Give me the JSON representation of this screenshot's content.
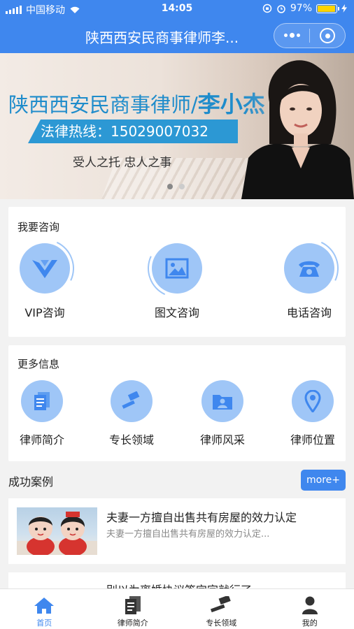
{
  "status": {
    "carrier": "中国移动",
    "time": "14:05",
    "battery": "97%",
    "battery_level": 0.97
  },
  "navbar": {
    "title": "陕西西安民商事律师李..."
  },
  "banner": {
    "title": "陕西西安民商事律师/",
    "name": "李小杰",
    "hotline": "法律热线：15029007032",
    "slogan": "受人之托   忠人之事"
  },
  "consult": {
    "title": "我要咨询",
    "items": [
      {
        "label": "VIP咨询",
        "icon": "vip-icon"
      },
      {
        "label": "图文咨询",
        "icon": "picture-icon"
      },
      {
        "label": "电话咨询",
        "icon": "phone-icon"
      }
    ]
  },
  "more_info": {
    "title": "更多信息",
    "items": [
      {
        "label": "律师简介",
        "icon": "document-icon"
      },
      {
        "label": "专长领域",
        "icon": "gavel-icon"
      },
      {
        "label": "律师风采",
        "icon": "folder-person-icon"
      },
      {
        "label": "律师位置",
        "icon": "location-pin-icon"
      }
    ]
  },
  "cases": {
    "title": "成功案例",
    "more_label": "more+",
    "items": [
      {
        "title": "夫妻一方擅自出售共有房屋的效力认定",
        "desc": "夫妻一方擅自出售共有房屋的效力认定..."
      },
      {
        "title": "别以为离婚协议签完字就行了"
      }
    ]
  },
  "tabbar": {
    "items": [
      {
        "label": "首页",
        "icon": "home-icon"
      },
      {
        "label": "律师简介",
        "icon": "document-icon"
      },
      {
        "label": "专长领域",
        "icon": "gavel-icon"
      },
      {
        "label": "我的",
        "icon": "user-icon"
      }
    ]
  },
  "colors": {
    "primary": "#3f87ee",
    "icon_bg": "#9fc6f7",
    "icon_fg": "#3f87ee",
    "banner_blue": "#2c98d4"
  }
}
